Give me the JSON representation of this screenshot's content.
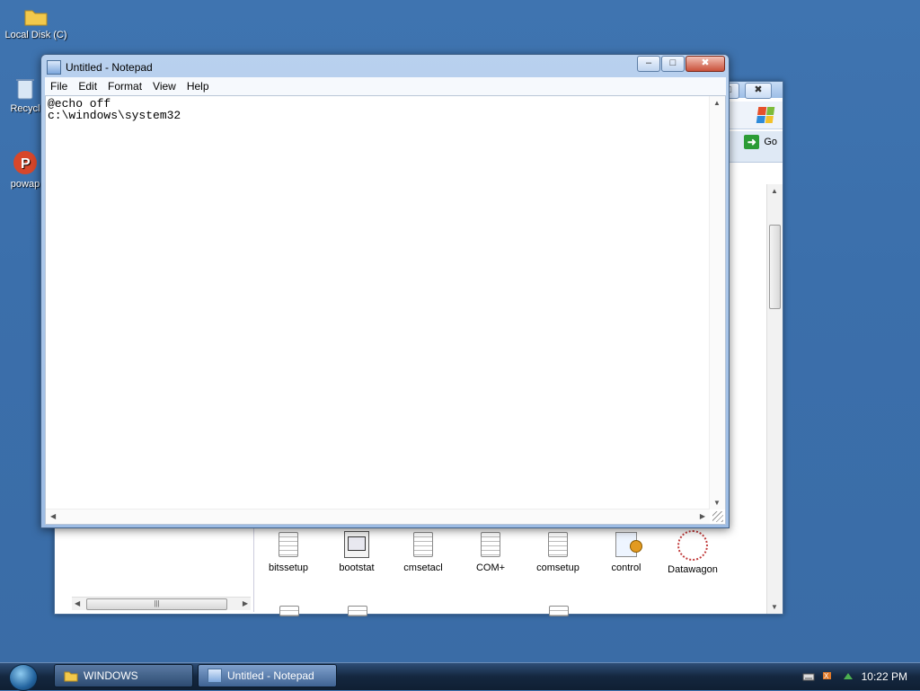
{
  "desktop": {
    "icons": [
      {
        "label": "Local Disk (C)",
        "icon": "folder-icon"
      },
      {
        "label": "Recycl",
        "icon": "recycle-bin-icon"
      },
      {
        "label": "powap",
        "icon": "app-icon"
      }
    ]
  },
  "explorer": {
    "go_label": "Go",
    "files": [
      {
        "label": "bitssetup",
        "icon": "text-file-icon"
      },
      {
        "label": "bootstat",
        "icon": "bootstat-icon"
      },
      {
        "label": "cmsetacl",
        "icon": "text-file-icon"
      },
      {
        "label": "COM+",
        "icon": "text-file-icon"
      },
      {
        "label": "comsetup",
        "icon": "text-file-icon"
      },
      {
        "label": "control",
        "icon": "control-icon"
      },
      {
        "label": "Datawagon",
        "icon": "datawagon-icon"
      }
    ]
  },
  "notepad": {
    "title": "Untitled - Notepad",
    "menu": [
      "File",
      "Edit",
      "Format",
      "View",
      "Help"
    ],
    "content": "@echo off\nc:\\windows\\system32"
  },
  "taskbar": {
    "items": [
      {
        "label": "WINDOWS",
        "active": false
      },
      {
        "label": "Untitled - Notepad",
        "active": true
      }
    ],
    "clock": "10:22 PM"
  },
  "colors": {
    "desktop": "#3a6ea5",
    "taskbar": "#14273f",
    "go_button": "#2c9c36"
  }
}
